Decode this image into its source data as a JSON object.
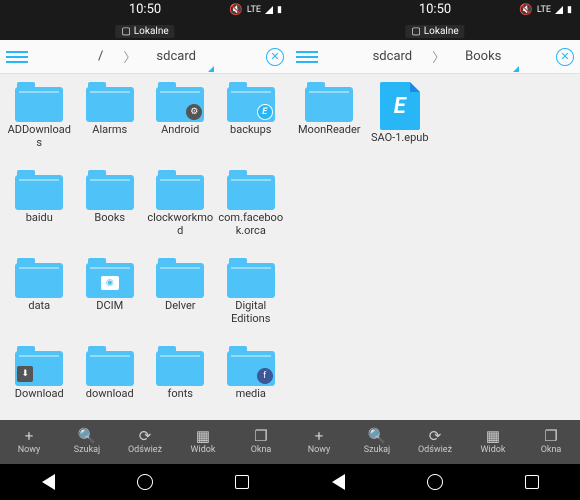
{
  "status": {
    "time": "10:50",
    "network": "LTE",
    "local_label": "Lokalne"
  },
  "left": {
    "crumb": {
      "parent": "/",
      "current": "sdcard"
    },
    "items": [
      {
        "label": "ADDownloads",
        "type": "folder"
      },
      {
        "label": "Alarms",
        "type": "folder"
      },
      {
        "label": "Android",
        "type": "folder",
        "badge": "gear"
      },
      {
        "label": "backups",
        "type": "folder",
        "badge": "es"
      },
      {
        "label": "baidu",
        "type": "folder"
      },
      {
        "label": "Books",
        "type": "folder"
      },
      {
        "label": "clockworkmod",
        "type": "folder"
      },
      {
        "label": "com.facebook.orca",
        "type": "folder"
      },
      {
        "label": "data",
        "type": "folder"
      },
      {
        "label": "DCIM",
        "type": "folder",
        "badge": "cam"
      },
      {
        "label": "Delver",
        "type": "folder"
      },
      {
        "label": "Digital Editions",
        "type": "folder"
      },
      {
        "label": "Download",
        "type": "folder",
        "badge": "dl"
      },
      {
        "label": "download",
        "type": "folder"
      },
      {
        "label": "fonts",
        "type": "folder"
      },
      {
        "label": "media",
        "type": "folder",
        "badge": "fb"
      }
    ]
  },
  "right": {
    "crumb": {
      "parent": "sdcard",
      "current": "Books"
    },
    "items": [
      {
        "label": "MoonReader",
        "type": "folder"
      },
      {
        "label": "SAO-1.epub",
        "type": "file"
      }
    ]
  },
  "toolbar": [
    {
      "icon": "+",
      "label": "Nowy"
    },
    {
      "icon": "search",
      "label": "Szukaj"
    },
    {
      "icon": "refresh",
      "label": "Odśwież"
    },
    {
      "icon": "grid",
      "label": "Widok"
    },
    {
      "icon": "windows",
      "label": "Okna"
    }
  ]
}
